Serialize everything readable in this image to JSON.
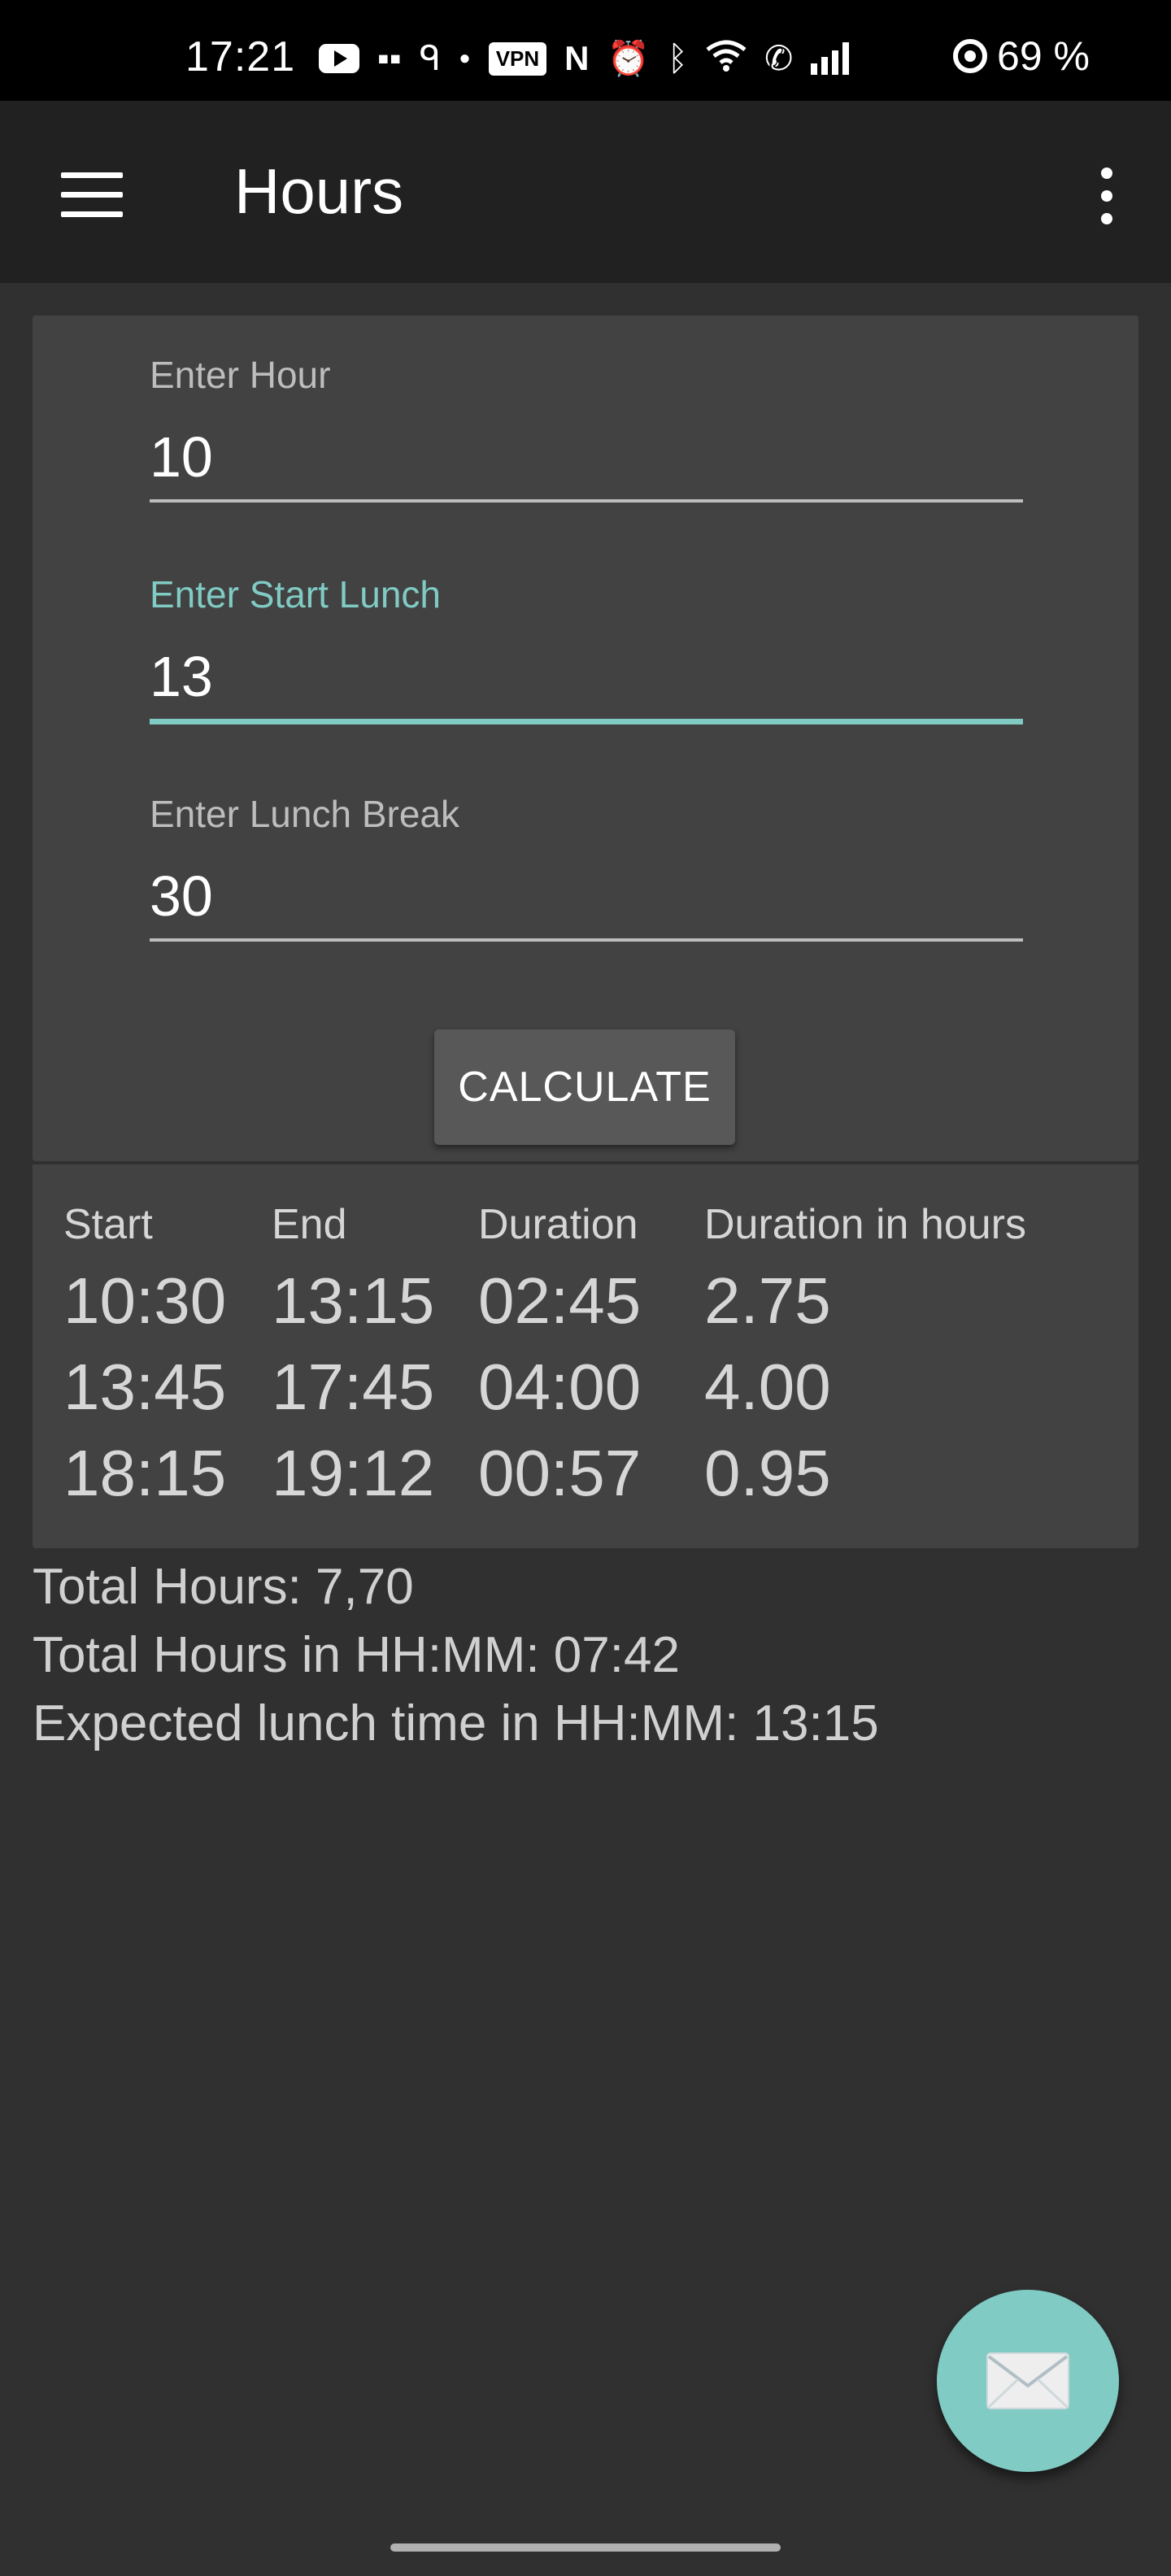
{
  "status_bar": {
    "time": "17:21",
    "vpn_label": "VPN",
    "battery": "69 %",
    "icons": [
      "youtube-icon",
      "messages-icon",
      "location-icon",
      "dot-icon",
      "vpn-icon",
      "nfc-icon",
      "alarm-icon",
      "bluetooth-icon",
      "wifi-icon",
      "wifi-calling-icon",
      "signal-icon",
      "battery-icon"
    ]
  },
  "app_bar": {
    "title": "Hours",
    "menu_icon": "hamburger-menu-icon",
    "overflow_icon": "more-vertical-icon"
  },
  "form": {
    "hour": {
      "label": "Enter Hour",
      "value": "10"
    },
    "start_lunch": {
      "label": "Enter Start Lunch",
      "value": "13"
    },
    "lunch_break": {
      "label": "Enter Lunch Break",
      "value": "30"
    },
    "calculate_label": "CALCULATE"
  },
  "results": {
    "headers": [
      "Start",
      "End",
      "Duration",
      "Duration in hours"
    ],
    "rows": [
      [
        "10:30",
        "13:15",
        "02:45",
        "2.75"
      ],
      [
        "13:45",
        "17:45",
        "04:00",
        "4.00"
      ],
      [
        "18:15",
        "19:12",
        "00:57",
        "0.95"
      ]
    ]
  },
  "totals": {
    "total_hours": "Total Hours: 7,70",
    "total_hhmm": "Total Hours in HH:MM: 07:42",
    "expected_lunch": "Expected lunch time in HH:MM: 13:15"
  },
  "fab": {
    "icon": "mail-icon"
  },
  "colors": {
    "accent": "#80cbc4",
    "background": "#303030",
    "card": "#424242",
    "app_bar": "#212121"
  }
}
